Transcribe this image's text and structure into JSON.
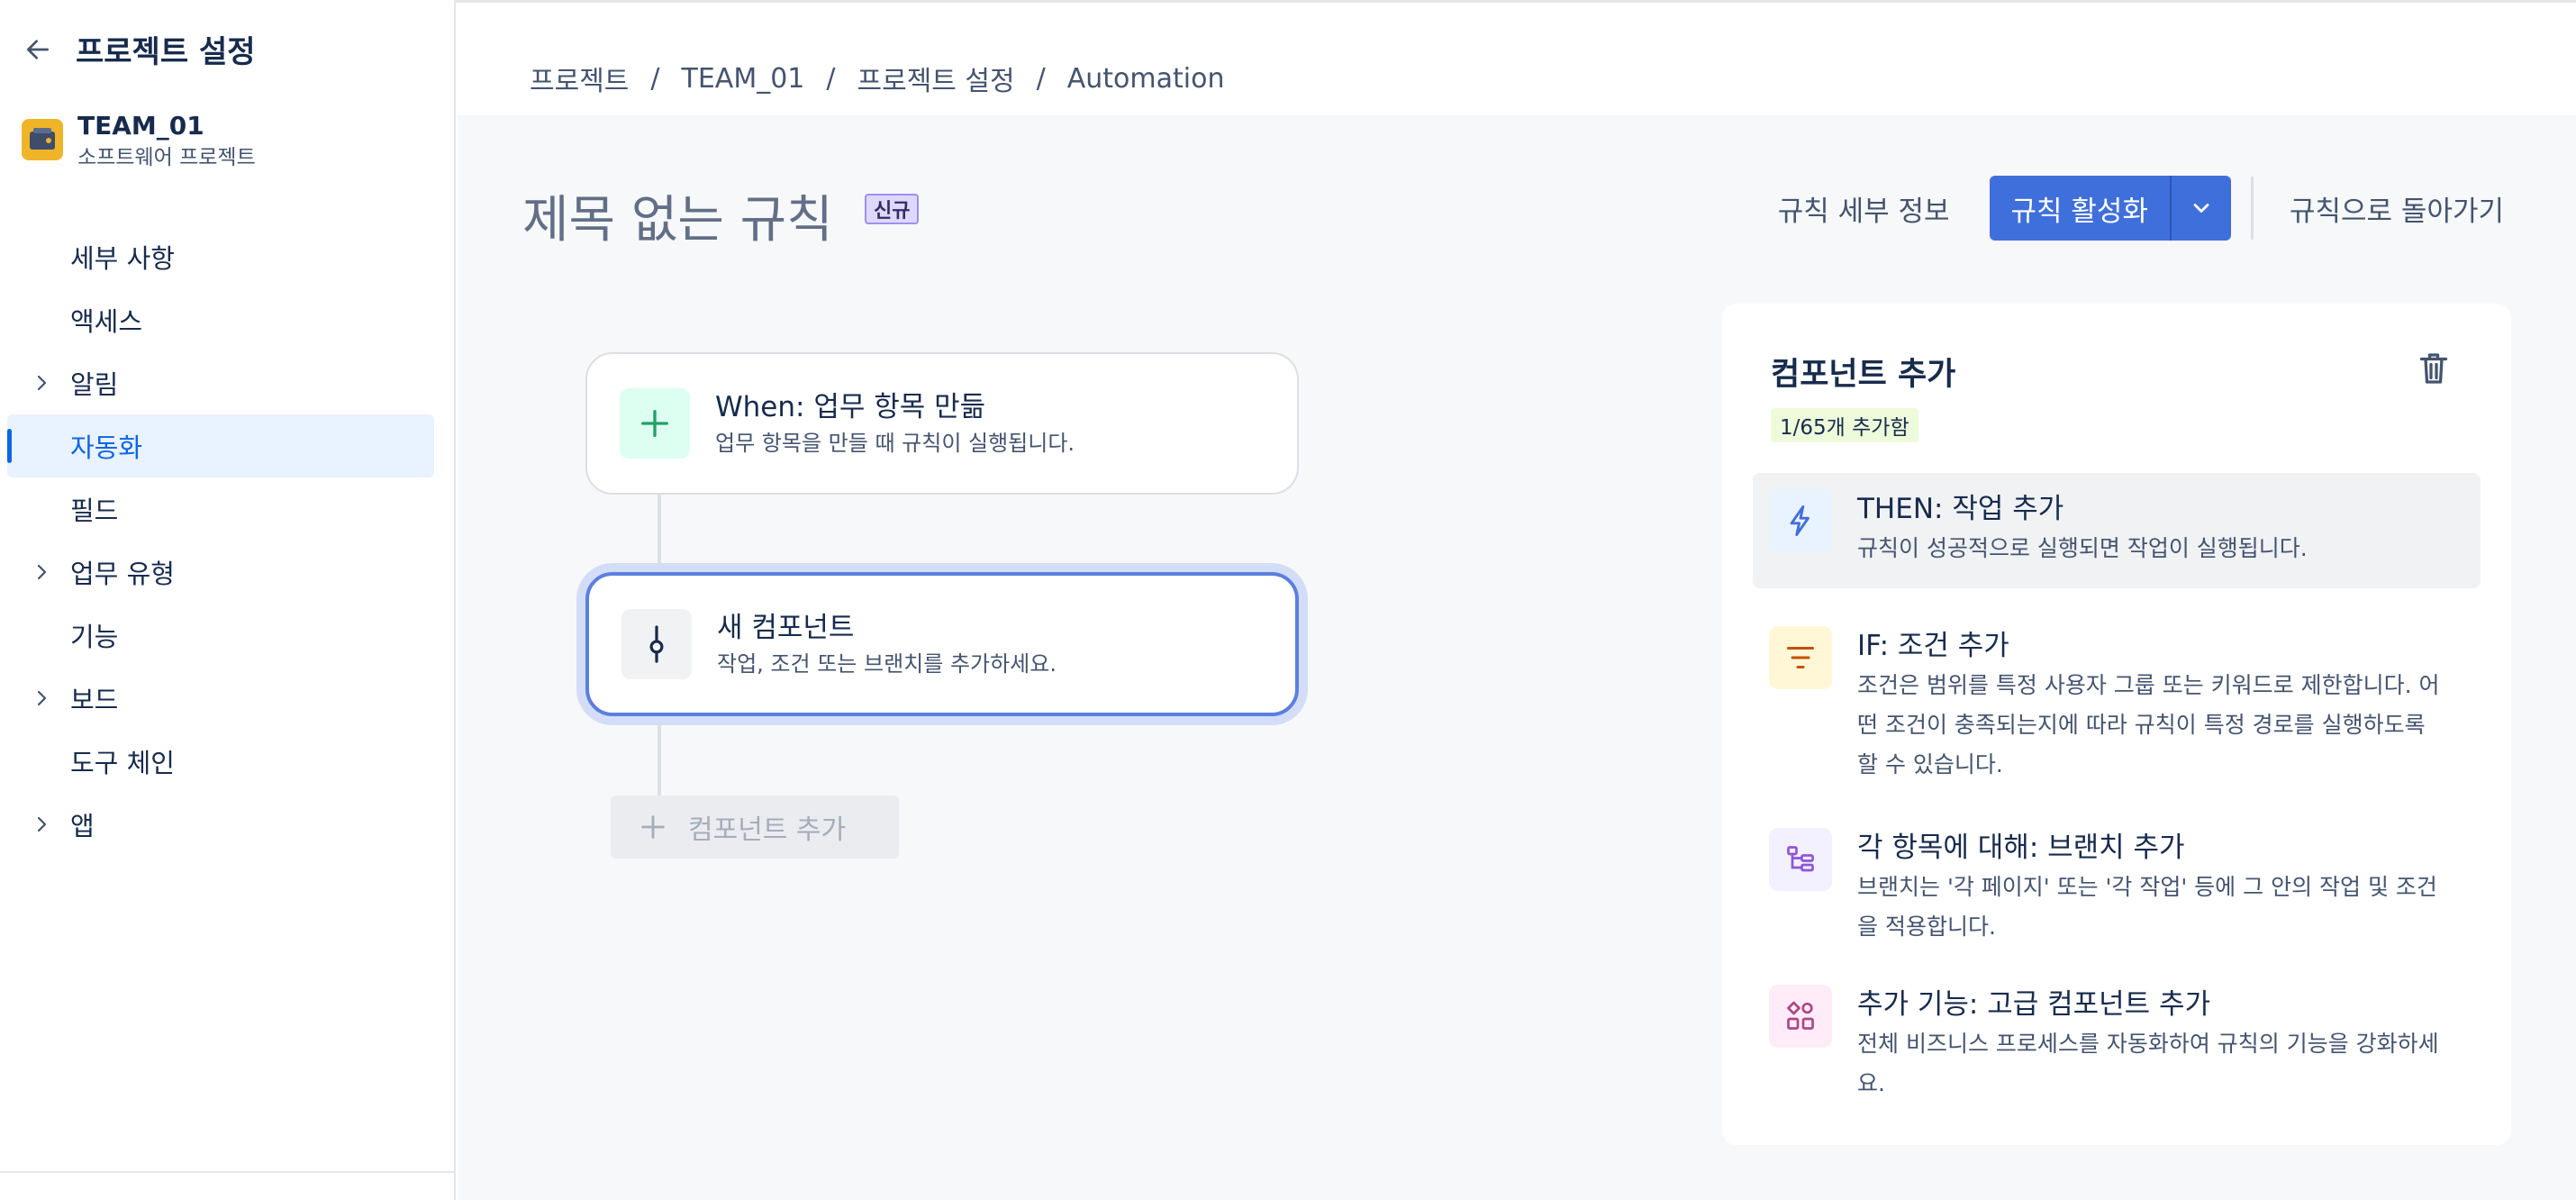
{
  "sidebar": {
    "title": "프로젝트 설정",
    "project": {
      "name": "TEAM_01",
      "type": "소프트웨어 프로젝트"
    },
    "items": [
      {
        "label": "세부 사항",
        "expandable": false,
        "active": false
      },
      {
        "label": "액세스",
        "expandable": false,
        "active": false
      },
      {
        "label": "알림",
        "expandable": true,
        "active": false
      },
      {
        "label": "자동화",
        "expandable": false,
        "active": true
      },
      {
        "label": "필드",
        "expandable": false,
        "active": false
      },
      {
        "label": "업무 유형",
        "expandable": true,
        "active": false
      },
      {
        "label": "기능",
        "expandable": false,
        "active": false
      },
      {
        "label": "보드",
        "expandable": true,
        "active": false
      },
      {
        "label": "도구 체인",
        "expandable": false,
        "active": false
      },
      {
        "label": "앱",
        "expandable": true,
        "active": false
      }
    ]
  },
  "breadcrumb": [
    "프로젝트",
    "TEAM_01",
    "프로젝트 설정",
    "Automation"
  ],
  "rule": {
    "title": "제목 없는 규칙",
    "badge": "신규"
  },
  "actions": {
    "details": "규칙 세부 정보",
    "activate": "규칙 활성화",
    "back": "규칙으로 돌아가기"
  },
  "flow": {
    "trigger": {
      "title": "When: 업무 항목 만듦",
      "desc": "업무 항목을 만들 때 규칙이 실행됩니다."
    },
    "new_component": {
      "title": "새 컴포넌트",
      "desc": "작업, 조건 또는 브랜치를 추가하세요."
    },
    "add_component": "컴포넌트 추가"
  },
  "panel": {
    "title": "컴포넌트 추가",
    "count": "1/65개 추가함",
    "options": [
      {
        "icon": "lightning-icon",
        "title": "THEN: 작업 추가",
        "desc": "규칙이 성공적으로 실행되면 작업이 실행됩니다."
      },
      {
        "icon": "filter-icon",
        "title": "IF: 조건 추가",
        "desc": "조건은 범위를 특정 사용자 그룹 또는 키워드로 제한합니다. 어떤 조건이 충족되는지에 따라 규칙이 특정 경로를 실행하도록 할 수 있습니다."
      },
      {
        "icon": "branch-icon",
        "title": "각 항목에 대해: 브랜치 추가",
        "desc": "브랜치는 '각 페이지' 또는 '각 작업' 등에 그 안의 작업 및 조건을 적용합니다."
      },
      {
        "icon": "components-icon",
        "title": "추가 기능: 고급 컴포넌트 추가",
        "desc": "전체 비즈니스 프로세스를 자동화하여 규칙의 기능을 강화하세요."
      }
    ]
  },
  "colors": {
    "primary": "#3f6fdb",
    "active_nav_text": "#0c66e4",
    "active_nav_bg": "#e9f2ff",
    "badge_bg": "#dfd8fd"
  }
}
